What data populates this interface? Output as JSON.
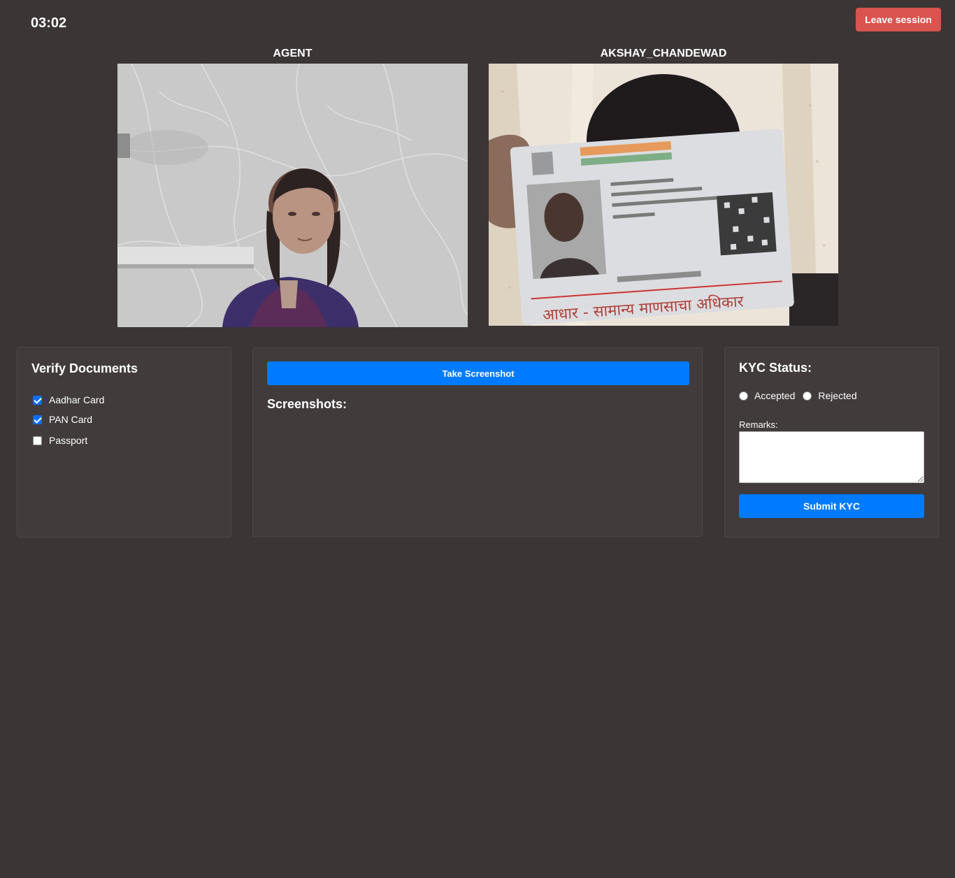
{
  "session": {
    "timer": "03:02",
    "leave_label": "Leave session"
  },
  "videos": {
    "agent_label": "AGENT",
    "user_label": "AKSHAY_CHANDEWAD",
    "id_card_footer": "आधार - सामान्य माणसाचा अधिकार"
  },
  "documents": {
    "title": "Verify Documents",
    "items": [
      {
        "label": "Aadhar Card",
        "checked": true
      },
      {
        "label": "PAN Card",
        "checked": true
      },
      {
        "label": "Passport",
        "checked": false
      }
    ]
  },
  "screenshots": {
    "button_label": "Take Screenshot",
    "title": "Screenshots:"
  },
  "kyc": {
    "title": "KYC Status:",
    "options": [
      "Accepted",
      "Rejected"
    ],
    "remarks_label": "Remarks:",
    "remarks_value": "",
    "submit_label": "Submit KYC"
  },
  "colors": {
    "background": "#3b3536",
    "panel": "#413b3c",
    "primary": "#007bff",
    "danger": "#d9534f"
  }
}
